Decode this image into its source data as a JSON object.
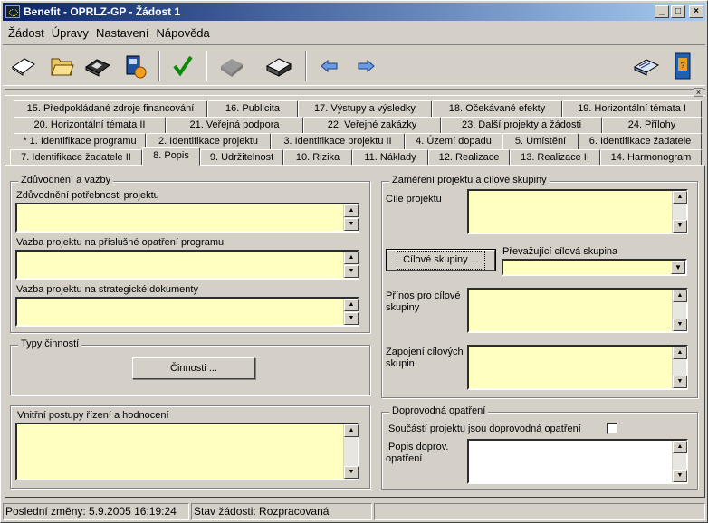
{
  "window": {
    "title": "Benefit - OPRLZ-GP - Žádost 1",
    "minimize_label": "_",
    "maximize_label": "□",
    "close_label": "×"
  },
  "menu": [
    "Žádost",
    "Úpravy",
    "Nastavení",
    "Nápověda"
  ],
  "toolbar": {
    "icons": [
      "new-document-icon",
      "open-folder-icon",
      "save-disk-icon",
      "export-icon",
      "check-icon",
      "import-icon",
      "print-icon",
      "back-arrow-icon",
      "forward-arrow-icon",
      "help-book-icon",
      "info-book-icon"
    ],
    "strip_close": "×"
  },
  "tabs": {
    "row1": [
      "15. Předpokládané zdroje financování",
      "16. Publicita",
      "17. Výstupy a výsledky",
      "18. Očekávané efekty",
      "19. Horizontální témata I"
    ],
    "row2": [
      "20. Horizontální témata II",
      "21. Veřejná podpora",
      "22. Veřejné zakázky",
      "23. Další projekty a žádosti",
      "24. Přílohy"
    ],
    "row3": [
      "* 1. Identifikace programu",
      "2. Identifikace projektu",
      "3. Identifikace projektu II",
      "4. Území dopadu",
      "5. Umístění",
      "6. Identifikace žadatele"
    ],
    "row4": [
      "7. Identifikace žadatele II",
      "8. Popis",
      "9. Udržitelnost",
      "10. Rizika",
      "11. Náklady",
      "12. Realizace",
      "13. Realizace II",
      "14. Harmonogram"
    ],
    "active": "8. Popis"
  },
  "form": {
    "zduvodneni": {
      "title": "Zdůvodnění a vazby",
      "potrebnost_label": "Zdůvodnění potřebnosti projektu",
      "potrebnost_value": "",
      "vazba_opatreni_label": "Vazba projektu na příslušné opatření programu",
      "vazba_opatreni_value": "",
      "vazba_dokumenty_label": "Vazba projektu na strategické dokumenty",
      "vazba_dokumenty_value": ""
    },
    "typy_cinnosti": {
      "title": "Typy činností",
      "button": "Činnosti ..."
    },
    "vnitrni_postupy": {
      "label": "Vnitřní postupy řízení a hodnocení",
      "value": ""
    },
    "zamereni": {
      "title": "Zaměření projektu a cílové skupiny",
      "cile_label": "Cíle projektu",
      "cile_value": "",
      "cilove_skupiny_button": "Cílové skupiny ...",
      "prevazujici_label": "Převažující cílová skupina",
      "prevazujici_value": "",
      "prinos_label_1": "Přínos pro cílové",
      "prinos_label_2": "skupiny",
      "prinos_value": "",
      "zapojeni_label_1": "Zapojení cílových",
      "zapojeni_label_2": "skupin",
      "zapojeni_value": ""
    },
    "doprovodna": {
      "title": "Doprovodná opatření",
      "soucasti_label": "Součástí projektu jsou doprovodná opatření",
      "soucasti_checked": false,
      "popis_label_1": "Popis doprov.",
      "popis_label_2": "opatření",
      "popis_value": ""
    }
  },
  "status": {
    "last_change": "Poslední změny: 5.9.2005 16:19:24",
    "state": "Stav žádosti: Rozpracovaná"
  }
}
